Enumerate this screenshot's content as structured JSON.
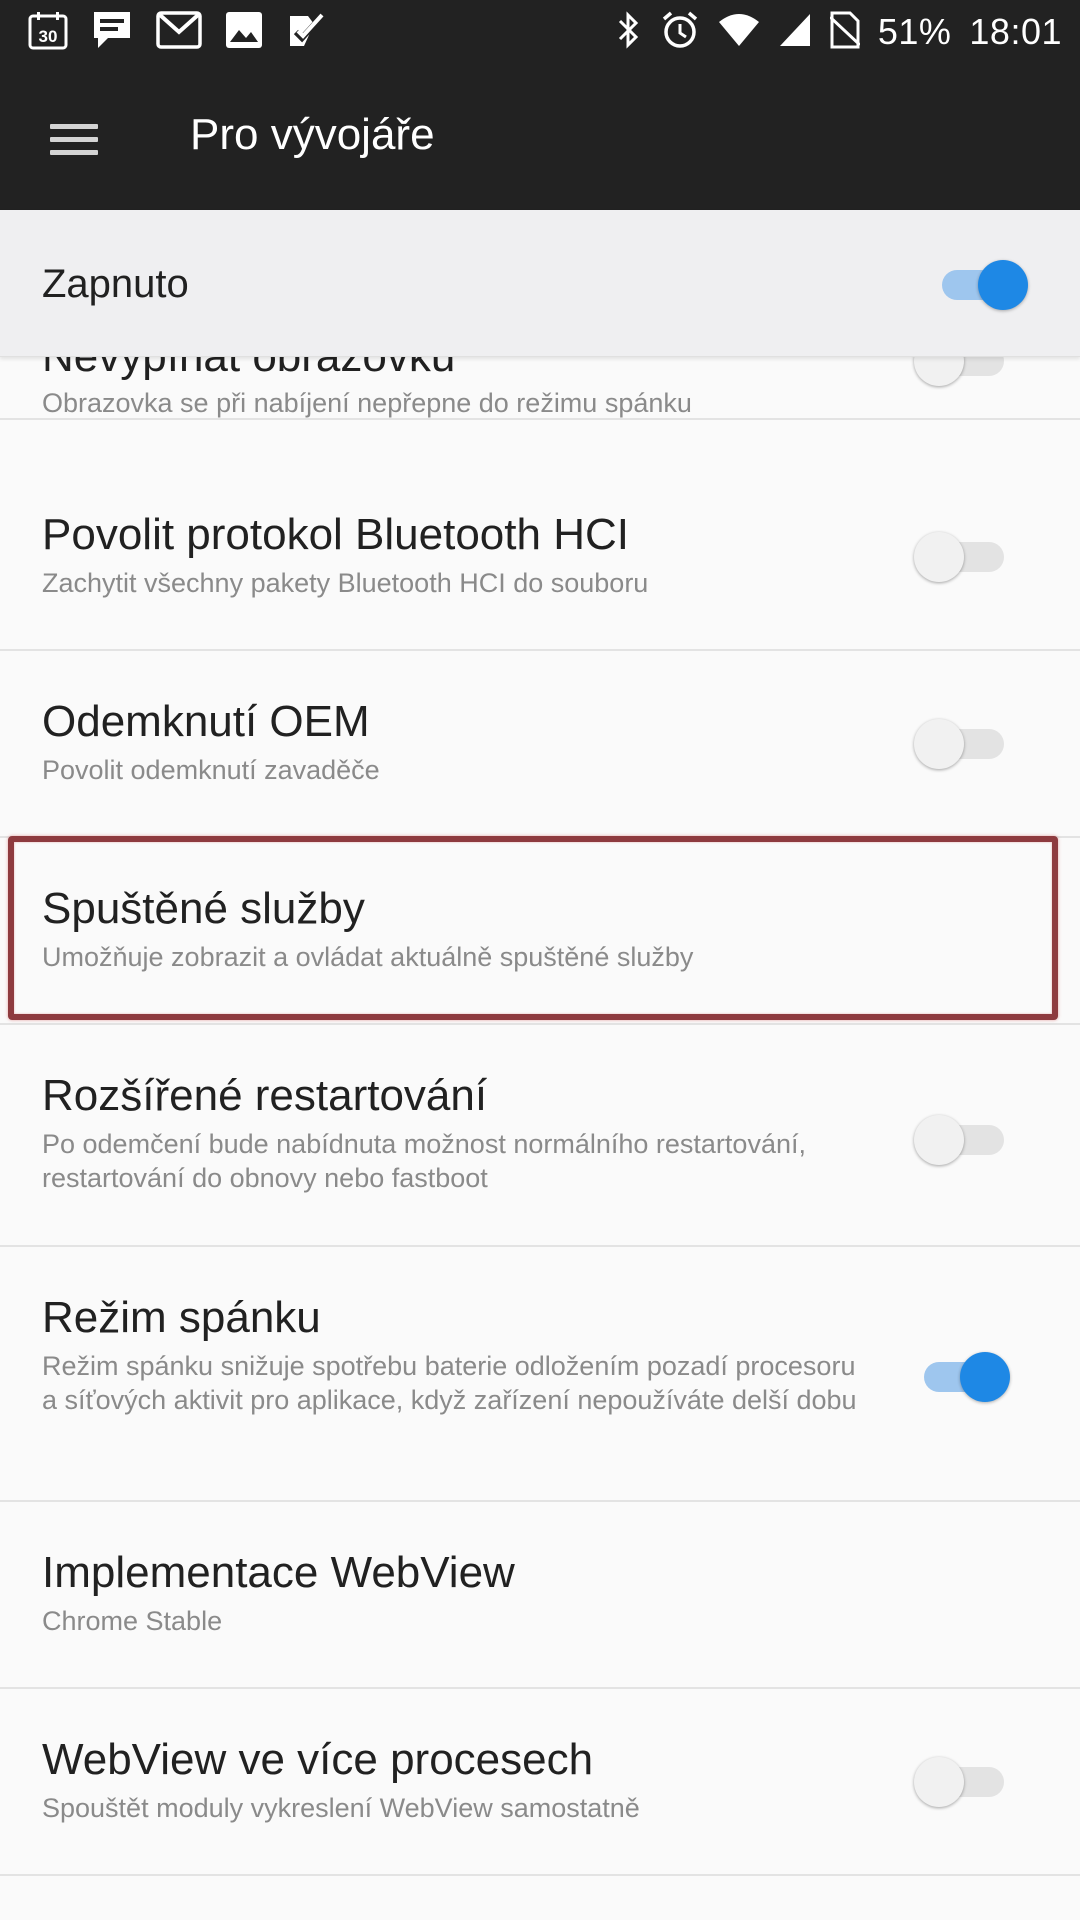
{
  "status_bar": {
    "left_icons": [
      "calendar-30-icon",
      "message-icon",
      "gmail-icon",
      "image-icon",
      "task-check-icon"
    ],
    "calendar_day": "30",
    "right_icons": [
      "bluetooth-icon",
      "alarm-icon",
      "wifi-icon",
      "cell-signal-icon",
      "no-sim-icon"
    ],
    "battery": "51%",
    "time": "18:01"
  },
  "app_bar": {
    "title": "Pro vývojáře",
    "menu_icon": "hamburger-menu-icon"
  },
  "master_switch": {
    "label": "Zapnuto",
    "checked": true
  },
  "settings": [
    {
      "title": "Nevypínat obrazovku",
      "summary": "Obrazovka se při nabíjení nepřepne do režimu spánku",
      "has_switch": true,
      "checked": false
    },
    {
      "title": "Povolit protokol Bluetooth HCI",
      "summary": "Zachytit všechny pakety Bluetooth HCI do souboru",
      "has_switch": true,
      "checked": false
    },
    {
      "title": "Odemknutí OEM",
      "summary": "Povolit odemknutí zavaděče",
      "has_switch": true,
      "checked": false
    },
    {
      "title": "Spuštěné služby",
      "summary": "Umožňuje zobrazit a ovládat aktuálně spuštěné služby",
      "has_switch": false,
      "highlighted": true
    },
    {
      "title": "Rozšířené restartování",
      "summary": "Po odemčení bude nabídnuta možnost normálního restartování, restartování do obnovy nebo fastboot",
      "has_switch": true,
      "checked": false
    },
    {
      "title": "Režim spánku",
      "summary": "Režim spánku snižuje spotřebu baterie odložením pozadí procesoru a síťových aktivit pro aplikace, když zařízení nepoužíváte delší dobu",
      "has_switch": true,
      "checked": true
    },
    {
      "title": "Implementace WebView",
      "summary": "Chrome Stable",
      "has_switch": false
    },
    {
      "title": "WebView ve více procesech",
      "summary": "Spouštět moduly vykreslení WebView samostatně",
      "has_switch": true,
      "checked": false
    }
  ],
  "colors": {
    "app_bar": "#222222",
    "accent": "#1e88e5",
    "highlight_border": "#8e3b3f"
  }
}
